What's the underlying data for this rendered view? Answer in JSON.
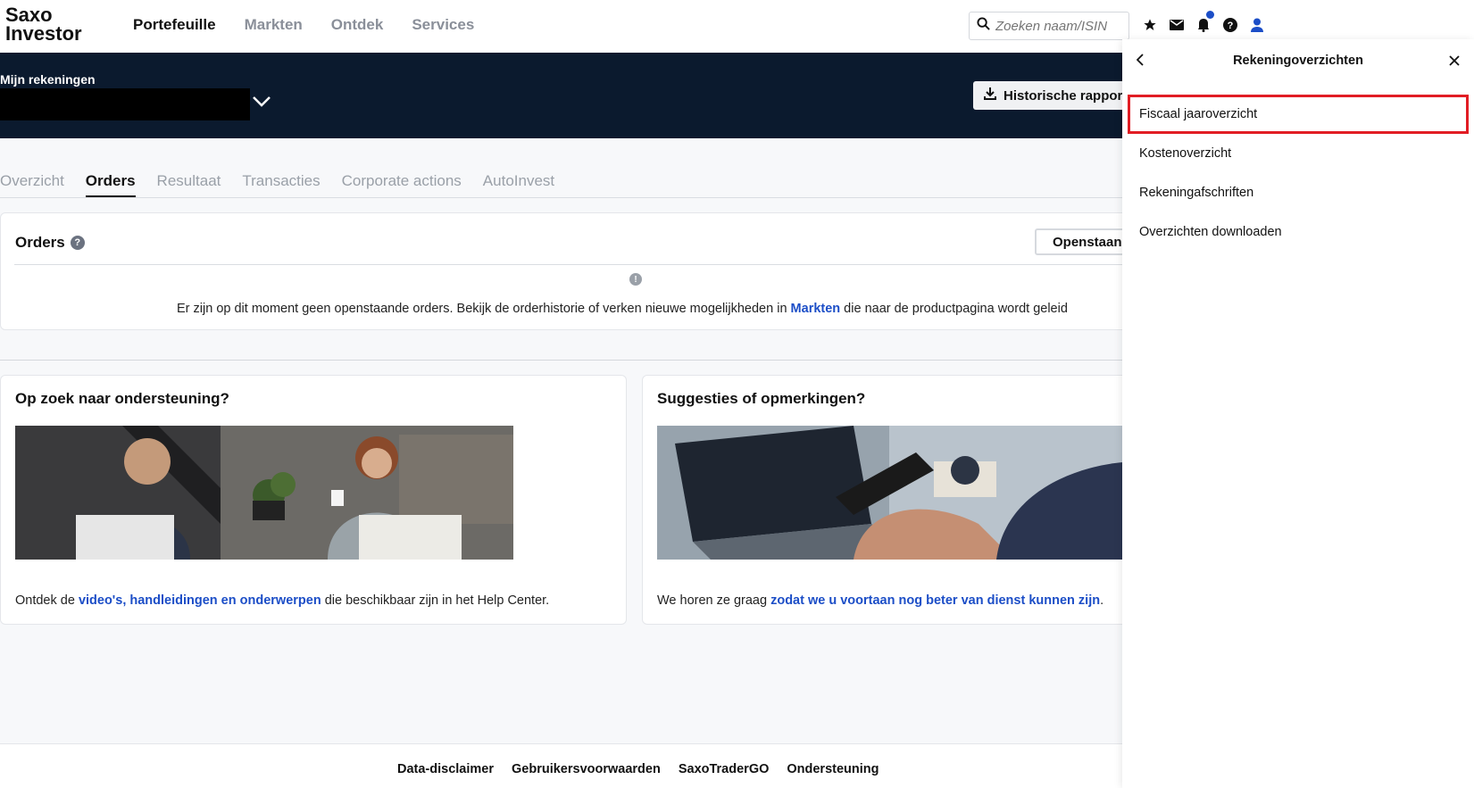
{
  "brand": {
    "line1": "Saxo",
    "line2": "Investor"
  },
  "nav": {
    "items": [
      "Portefeuille",
      "Markten",
      "Ontdek",
      "Services"
    ],
    "active": "Portefeuille"
  },
  "search": {
    "placeholder": "Zoeken naam/ISIN"
  },
  "top_icons": [
    "star-icon",
    "mail-icon",
    "notifications-icon",
    "help-icon",
    "user-icon"
  ],
  "accounts": {
    "label": "Mijn rekeningen",
    "historic_button": "Historische rapporte"
  },
  "tabs": {
    "items": [
      "Overzicht",
      "Orders",
      "Resultaat",
      "Transacties",
      "Corporate actions",
      "AutoInvest"
    ],
    "active": "Orders"
  },
  "orders": {
    "title": "Orders",
    "filter_button": "Openstaanc",
    "empty_text_before": "Er zijn op dit moment geen openstaande orders. Bekijk de orderhistorie of verken nieuwe mogelijkheden in ",
    "empty_link": "Markten",
    "empty_text_after": " die naar de productpagina wordt geleid"
  },
  "support_card": {
    "title": "Op zoek naar ondersteuning?",
    "text_before": "Ontdek de ",
    "link": "video's, handleidingen en onderwerpen",
    "text_after": " die beschikbaar zijn in het Help Center."
  },
  "feedback_card": {
    "title": "Suggesties of opmerkingen?",
    "text_before": "We horen ze graag ",
    "link": "zodat we u voortaan nog beter van dienst kunnen zijn",
    "text_after": "."
  },
  "footer": {
    "links": [
      "Data-disclaimer",
      "Gebruikersvoorwaarden",
      "SaxoTraderGO",
      "Ondersteuning"
    ]
  },
  "panel": {
    "title": "Rekeningoverzichten",
    "items": [
      "Fiscaal jaaroverzicht",
      "Kostenoverzicht",
      "Rekeningafschriften",
      "Overzichten downloaden"
    ],
    "highlighted": "Fiscaal jaaroverzicht"
  },
  "colors": {
    "accent": "#1c4ec7",
    "band": "#0b1a2e",
    "highlight": "#e11d24"
  }
}
